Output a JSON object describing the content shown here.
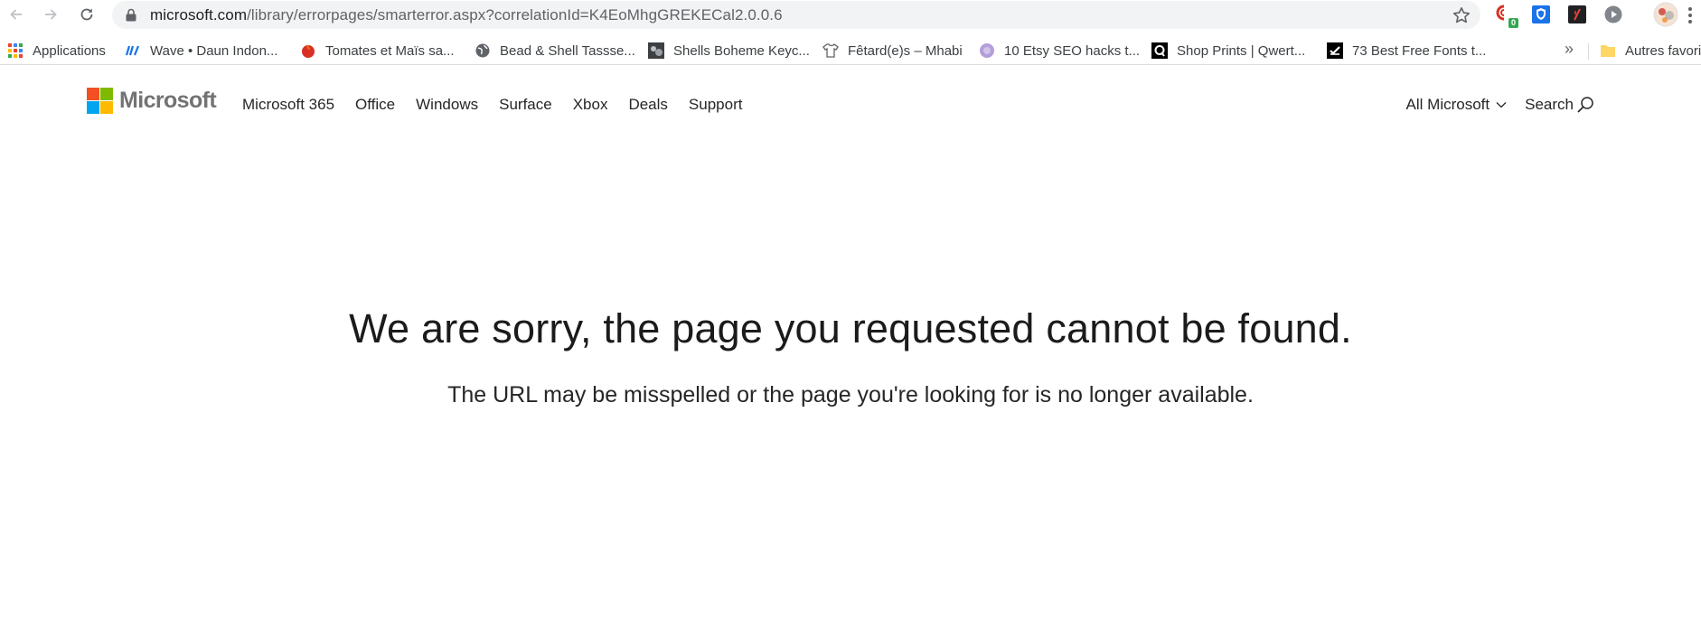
{
  "browser": {
    "url_host": "microsoft.com",
    "url_path": "/library/errorpages/smarterror.aspx?correlationId=K4EoMhgGREKECal2.0.0.6",
    "extension_badge": "0"
  },
  "bookmarks": {
    "items": [
      {
        "label": "Applications",
        "icon": "apps-grid-icon"
      },
      {
        "label": "Wave • Daun Indon...",
        "icon": "wave-icon"
      },
      {
        "label": "Tomates et Maïs sa...",
        "icon": "tomato-icon"
      },
      {
        "label": "Bead & Shell Tassse...",
        "icon": "globe-icon"
      },
      {
        "label": "Shells Boheme Keyc...",
        "icon": "photo-icon"
      },
      {
        "label": "Fêtard(e)s – Mhabi",
        "icon": "shirt-icon"
      },
      {
        "label": "10 Etsy SEO hacks t...",
        "icon": "etsy-icon"
      },
      {
        "label": "Shop Prints | Qwert...",
        "icon": "q-icon"
      },
      {
        "label": "73 Best Free Fonts t...",
        "icon": "fonts-icon"
      }
    ],
    "more": "»",
    "other_label": "Autres favori"
  },
  "ms_header": {
    "logo_text": "Microsoft",
    "nav": [
      "Microsoft 365",
      "Office",
      "Windows",
      "Surface",
      "Xbox",
      "Deals",
      "Support"
    ],
    "all_microsoft": "All Microsoft",
    "search": "Search"
  },
  "error": {
    "title": "We are sorry, the page you requested cannot be found.",
    "subtitle": "The URL may be misspelled or the page you're looking for is no longer available."
  },
  "colors": {
    "ms_red": "#f25022",
    "ms_green": "#7fba00",
    "ms_blue": "#00a4ef",
    "ms_yellow": "#ffb900",
    "omnibox_bg": "#f1f3f4"
  }
}
